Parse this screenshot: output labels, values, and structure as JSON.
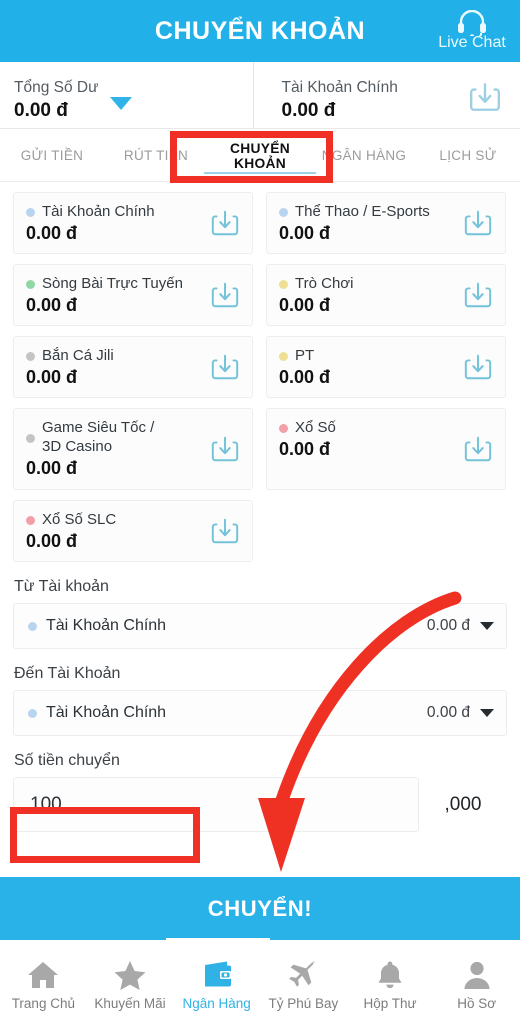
{
  "header": {
    "title": "CHUYỂN KHOẢN",
    "live_chat_label": "Live Chat",
    "live_chat_icon": "headset-icon",
    "bg_color": "#22b0e8"
  },
  "balance_bar": {
    "total": {
      "label": "Tổng Số Dư",
      "value": "0.00 đ",
      "caret_icon": "caret-down-icon"
    },
    "main": {
      "label": "Tài Khoản Chính",
      "value": "0.00 đ",
      "download_icon": "download-tray-icon"
    }
  },
  "tabs": [
    {
      "label": "GỬI TIỀN",
      "active": false
    },
    {
      "label": "RÚT TIỀN",
      "active": false
    },
    {
      "label": "CHUYỂN KHOẢN",
      "active": true
    },
    {
      "label": "NGÂN HÀNG",
      "active": false
    },
    {
      "label": "LỊCH SỬ",
      "active": false
    }
  ],
  "wallets": [
    {
      "name": "Tài Khoản Chính",
      "amount": "0.00 đ",
      "dot_color": "#b9d4ef",
      "icon": "download-tray-icon",
      "tall": false
    },
    {
      "name": "Thể Thao / E-Sports",
      "amount": "0.00 đ",
      "dot_color": "#b9d4ef",
      "icon": "download-tray-icon",
      "tall": false
    },
    {
      "name": "Sòng Bài Trực Tuyến",
      "amount": "0.00 đ",
      "dot_color": "#8fd8a4",
      "icon": "download-tray-icon",
      "tall": false
    },
    {
      "name": "Trò Chơi",
      "amount": "0.00 đ",
      "dot_color": "#efdf93",
      "icon": "download-tray-icon",
      "tall": false
    },
    {
      "name": "Bắn Cá Jili",
      "amount": "0.00 đ",
      "dot_color": "#c4c4c4",
      "icon": "download-tray-icon",
      "tall": false
    },
    {
      "name": "PT",
      "amount": "0.00 đ",
      "dot_color": "#efdf93",
      "icon": "download-tray-icon",
      "tall": false
    },
    {
      "name": "Game Siêu Tốc /\n3D Casino",
      "amount": "0.00 đ",
      "dot_color": "#c4c4c4",
      "icon": "download-tray-icon",
      "tall": true
    },
    {
      "name": "Xổ Số",
      "amount": "0.00 đ",
      "dot_color": "#f29fa8",
      "icon": "download-tray-icon",
      "tall": true
    },
    {
      "name": "Xổ Số SLC",
      "amount": "0.00 đ",
      "dot_color": "#f29fa8",
      "icon": "download-tray-icon",
      "tall": false
    }
  ],
  "form": {
    "from_label": "Từ Tài khoản",
    "from_account": {
      "name": "Tài Khoản Chính",
      "value": "0.00 đ",
      "caret_icon": "caret-down-icon"
    },
    "to_label": "Đến Tài Khoản",
    "to_account": {
      "name": "Tài Khoản Chính",
      "value": "0.00 đ",
      "caret_icon": "caret-down-icon"
    },
    "amount_label": "Số tiền chuyển",
    "amount_value": "100",
    "amount_placeholder": "",
    "amount_suffix": ",000"
  },
  "submit": {
    "label": "CHUYỂN!",
    "bg_color": "#29b2e8"
  },
  "bottom_nav": [
    {
      "label": "Trang Chủ",
      "icon": "home-icon",
      "active": false
    },
    {
      "label": "Khuyến Mãi",
      "icon": "star-icon",
      "active": false
    },
    {
      "label": "Ngân Hàng",
      "icon": "wallet-icon",
      "active": true
    },
    {
      "label": "Tỷ Phú Bay",
      "icon": "airplane-icon",
      "active": false
    },
    {
      "label": "Hộp Thư",
      "icon": "bell-icon",
      "active": false
    },
    {
      "label": "Hồ Sơ",
      "icon": "person-icon",
      "active": false
    }
  ],
  "annotations": {
    "color": "#f03024",
    "highlight_tab": "CHUYỂN KHOẢN",
    "highlight_input": "100",
    "arrow_icon": "curved-arrow-down-icon"
  }
}
